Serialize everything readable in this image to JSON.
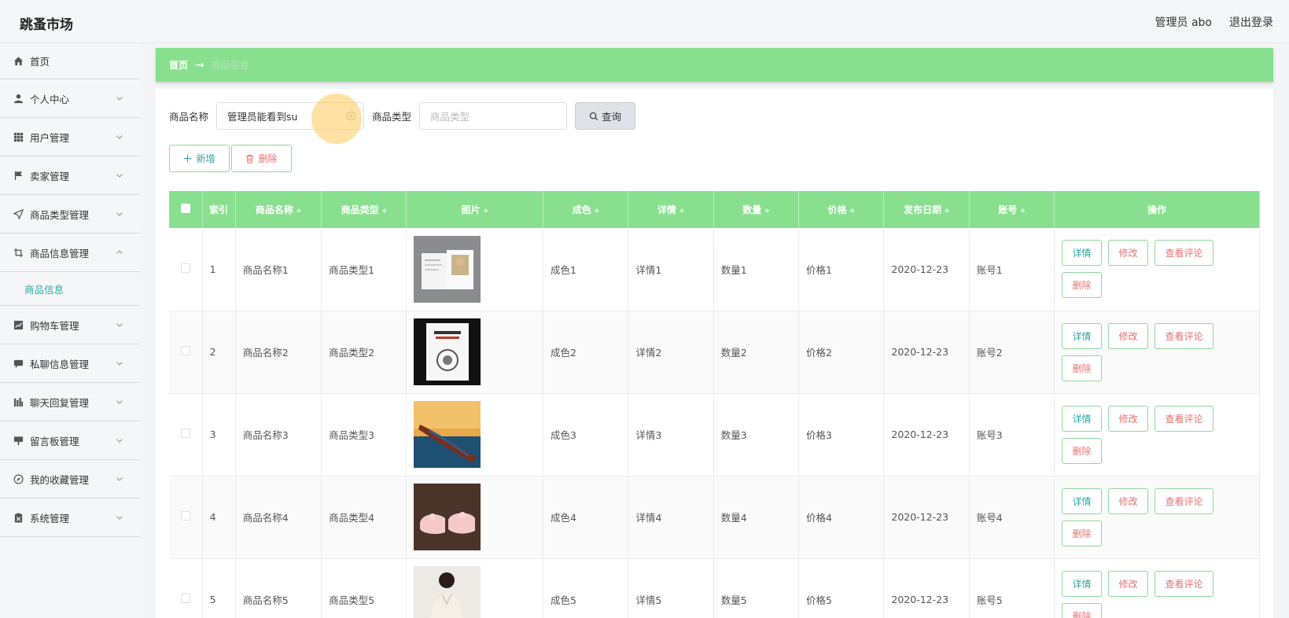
{
  "header": {
    "brand": "跳蚤市场",
    "user_label": "管理员 abo",
    "logout_label": "退出登录"
  },
  "sidebar": {
    "items": [
      {
        "label": "首页",
        "icon": "home-icon"
      },
      {
        "label": "个人中心",
        "icon": "user-icon"
      },
      {
        "label": "用户管理",
        "icon": "grid-icon"
      },
      {
        "label": "卖家管理",
        "icon": "flag-icon"
      },
      {
        "label": "商品类型管理",
        "icon": "send-icon"
      },
      {
        "label": "商品信息管理",
        "icon": "crop-icon",
        "expanded": true
      },
      {
        "label": "购物车管理",
        "icon": "chart-icon"
      },
      {
        "label": "私聊信息管理",
        "icon": "chat-icon"
      },
      {
        "label": "聊天回复管理",
        "icon": "bars-icon"
      },
      {
        "label": "留言板管理",
        "icon": "board-icon"
      },
      {
        "label": "我的收藏管理",
        "icon": "compass-icon"
      },
      {
        "label": "系统管理",
        "icon": "clipboard-icon"
      }
    ],
    "sub_item": "商品信息"
  },
  "breadcrumb": {
    "home": "首页",
    "arrow": "→",
    "current": "商品信息"
  },
  "search": {
    "name_label": "商品名称",
    "name_value": "管理员能看到su",
    "type_label": "商品类型",
    "type_placeholder": "商品类型",
    "query_label": "查询"
  },
  "actions": {
    "add_label": "新增",
    "delete_label": "删除"
  },
  "table": {
    "headers": [
      "索引",
      "商品名称",
      "商品类型",
      "图片",
      "成色",
      "详情",
      "数量",
      "价格",
      "发布日期",
      "账号",
      "操作"
    ],
    "op_labels": {
      "detail": "详情",
      "edit": "修改",
      "review": "查看评论",
      "delete": "删除"
    },
    "rows": [
      {
        "index": "1",
        "name": "商品名称1",
        "type": "商品类型1",
        "condition": "成色1",
        "detail": "详情1",
        "qty": "数量1",
        "price": "价格1",
        "date": "2020-12-23",
        "account": "账号1"
      },
      {
        "index": "2",
        "name": "商品名称2",
        "type": "商品类型2",
        "condition": "成色2",
        "detail": "详情2",
        "qty": "数量2",
        "price": "价格2",
        "date": "2020-12-23",
        "account": "账号2"
      },
      {
        "index": "3",
        "name": "商品名称3",
        "type": "商品类型3",
        "condition": "成色3",
        "detail": "详情3",
        "qty": "数量3",
        "price": "价格3",
        "date": "2020-12-23",
        "account": "账号3"
      },
      {
        "index": "4",
        "name": "商品名称4",
        "type": "商品类型4",
        "condition": "成色4",
        "detail": "详情4",
        "qty": "数量4",
        "price": "价格4",
        "date": "2020-12-23",
        "account": "账号4"
      },
      {
        "index": "5",
        "name": "商品名称5",
        "type": "商品类型5",
        "condition": "成色5",
        "detail": "详情5",
        "qty": "数量5",
        "price": "价格5",
        "date": "2020-12-23",
        "account": "账号5"
      }
    ]
  },
  "colors": {
    "accent_green": "#88e08e",
    "teal_text": "#2aa9a1",
    "danger_text": "#e57373"
  }
}
